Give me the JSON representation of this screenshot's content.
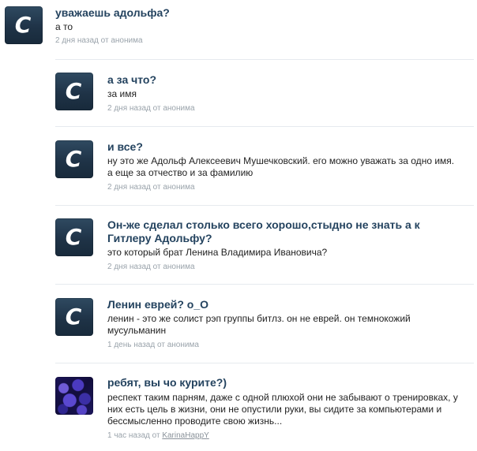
{
  "items": [
    {
      "title": "уважаешь адольфа?",
      "body": "а то",
      "time": "2 дня назад",
      "from": "от",
      "author": "анонима"
    },
    {
      "title": "а за что?",
      "body": "за имя",
      "time": "2 дня назад",
      "from": "от",
      "author": "анонима"
    },
    {
      "title": "и все?",
      "body": "ну это же Адольф Алексеевич Мушечковский. его можно уважать за одно имя. а еще за отчество и за фамилию",
      "time": "2 дня назад",
      "from": "от",
      "author": "анонима"
    },
    {
      "title": "Он-же сделал столько всего хорошо,стыдно не знать а к Гитлеру Адольфу?",
      "body": "это который брат Ленина Владимира Ивановича?",
      "time": "2 дня назад",
      "from": "от",
      "author": "анонима"
    },
    {
      "title": "Ленин еврей? о_О",
      "body": "ленин - это же солист рэп группы битлз. он не еврей. он темнокожий мусульманин",
      "time": "1 день назад",
      "from": "от",
      "author": "анонима"
    },
    {
      "title": "ребят, вы чо курите?)",
      "body": "респект таким парням, даже с одной плюхой они не забывают о тренировках, у них есть цель в жизни, они не опустили руки, вы сидите за компьютерами и бессмысленно проводите свою жизнь...",
      "time": "1 час назад",
      "from": "от",
      "author": "KarinaHappY"
    }
  ],
  "avatar_letter": "C",
  "colors": {
    "title": "#24435f",
    "meta": "#9aa3ab",
    "avatar": "#1f3347"
  }
}
